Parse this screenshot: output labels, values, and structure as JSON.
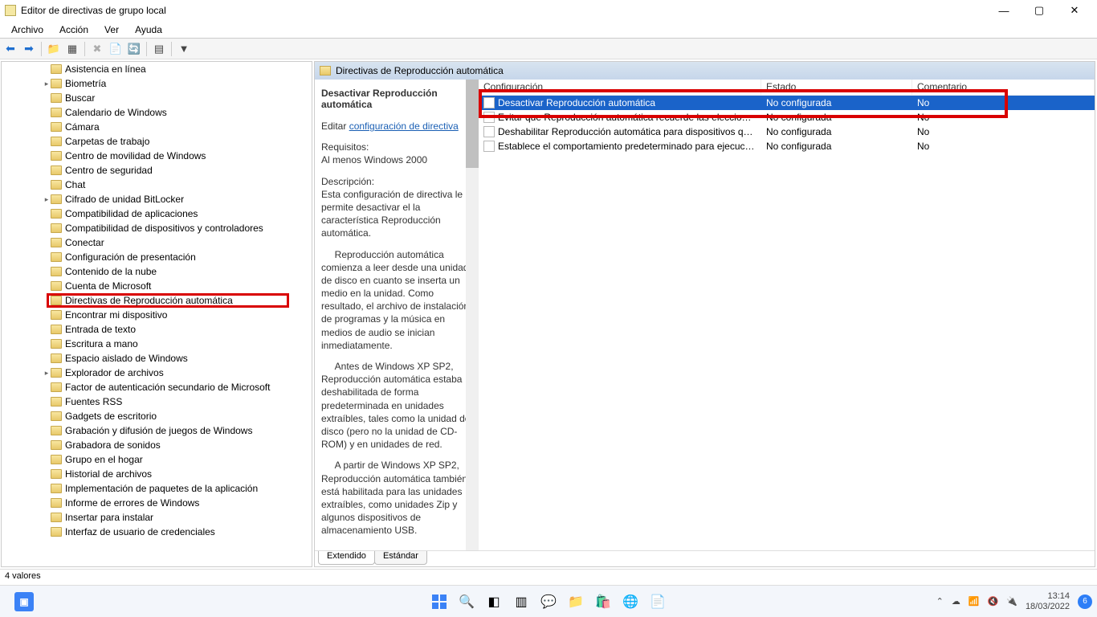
{
  "window": {
    "title": "Editor de directivas de grupo local"
  },
  "menu": {
    "file": "Archivo",
    "action": "Acción",
    "view": "Ver",
    "help": "Ayuda"
  },
  "tree": {
    "items": [
      {
        "label": "Asistencia en línea",
        "exp": ""
      },
      {
        "label": "Biometría",
        "exp": "▸"
      },
      {
        "label": "Buscar",
        "exp": ""
      },
      {
        "label": "Calendario de Windows",
        "exp": ""
      },
      {
        "label": "Cámara",
        "exp": ""
      },
      {
        "label": "Carpetas de trabajo",
        "exp": ""
      },
      {
        "label": "Centro de movilidad de Windows",
        "exp": ""
      },
      {
        "label": "Centro de seguridad",
        "exp": ""
      },
      {
        "label": "Chat",
        "exp": ""
      },
      {
        "label": "Cifrado de unidad BitLocker",
        "exp": "▸"
      },
      {
        "label": "Compatibilidad de aplicaciones",
        "exp": ""
      },
      {
        "label": "Compatibilidad de dispositivos y controladores",
        "exp": ""
      },
      {
        "label": "Conectar",
        "exp": ""
      },
      {
        "label": "Configuración de presentación",
        "exp": ""
      },
      {
        "label": "Contenido de la nube",
        "exp": ""
      },
      {
        "label": "Cuenta de Microsoft",
        "exp": ""
      },
      {
        "label": "Directivas de Reproducción automática",
        "exp": "",
        "selected": true
      },
      {
        "label": "Encontrar mi dispositivo",
        "exp": ""
      },
      {
        "label": "Entrada de texto",
        "exp": ""
      },
      {
        "label": "Escritura a mano",
        "exp": ""
      },
      {
        "label": "Espacio aislado de Windows",
        "exp": ""
      },
      {
        "label": "Explorador de archivos",
        "exp": "▸"
      },
      {
        "label": "Factor de autenticación secundario de Microsoft",
        "exp": ""
      },
      {
        "label": "Fuentes RSS",
        "exp": ""
      },
      {
        "label": "Gadgets de escritorio",
        "exp": ""
      },
      {
        "label": "Grabación y difusión de juegos de Windows",
        "exp": ""
      },
      {
        "label": "Grabadora de sonidos",
        "exp": ""
      },
      {
        "label": "Grupo en el hogar",
        "exp": ""
      },
      {
        "label": "Historial de archivos",
        "exp": ""
      },
      {
        "label": "Implementación de paquetes de la aplicación",
        "exp": ""
      },
      {
        "label": "Informe de errores de Windows",
        "exp": ""
      },
      {
        "label": "Insertar para instalar",
        "exp": ""
      },
      {
        "label": "Interfaz de usuario de credenciales",
        "exp": ""
      }
    ]
  },
  "right": {
    "header": "Directivas de Reproducción automática",
    "desc": {
      "name": "Desactivar Reproducción automática",
      "edit": "Editar",
      "edit_link": "configuración de directiva",
      "req_label": "Requisitos:",
      "req_value": "Al menos Windows 2000",
      "desc_label": "Descripción:",
      "p1": "Esta configuración de directiva le permite desactivar el la característica Reproducción automática.",
      "p2": "Reproducción automática comienza a leer desde una unidad de disco en cuanto se inserta un medio en la unidad. Como resultado, el archivo de instalación de programas y la música en medios de audio se inician inmediatamente.",
      "p3": "Antes de Windows XP SP2, Reproducción automática estaba deshabilitada de forma predeterminada en unidades extraíbles, tales como la unidad de disco (pero no la unidad de CD-ROM) y en unidades de red.",
      "p4": "A partir de Windows XP SP2, Reproducción automática también está habilitada para las unidades extraíbles, como unidades Zip y algunos dispositivos de almacenamiento USB."
    },
    "cols": {
      "conf": "Configuración",
      "estado": "Estado",
      "com": "Comentario"
    },
    "rows": [
      {
        "conf": "Desactivar Reproducción automática",
        "estado": "No configurada",
        "com": "No",
        "selected": true
      },
      {
        "conf": "Evitar que Reproducción automática recuerde las elecciones...",
        "estado": "No configurada",
        "com": "No"
      },
      {
        "conf": "Deshabilitar Reproducción automática para dispositivos que...",
        "estado": "No configurada",
        "com": "No"
      },
      {
        "conf": "Establece el comportamiento predeterminado para ejecució...",
        "estado": "No configurada",
        "com": "No"
      }
    ],
    "tabs": {
      "ext": "Extendido",
      "std": "Estándar"
    }
  },
  "status": {
    "text": "4 valores"
  },
  "tray": {
    "time": "13:14",
    "date": "18/03/2022",
    "notif": "6"
  }
}
